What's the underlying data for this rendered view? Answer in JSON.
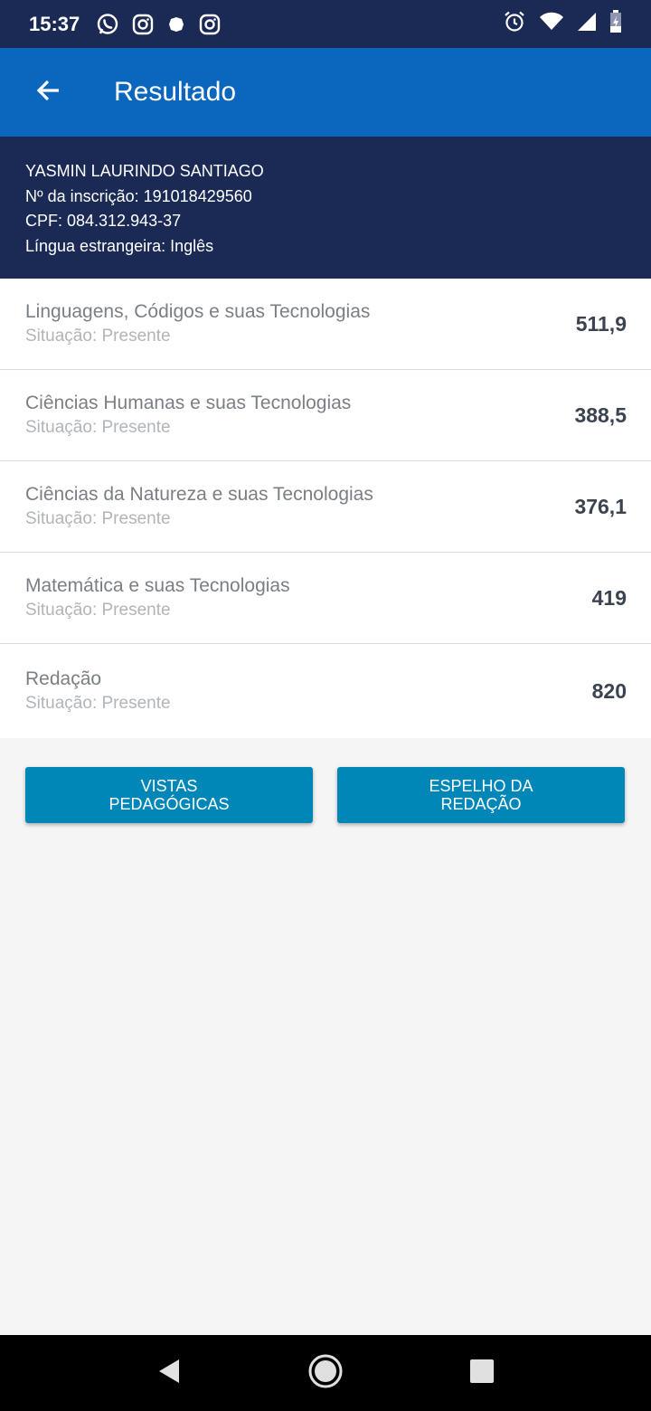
{
  "status_bar": {
    "time": "15:37",
    "left_icons": [
      "whatsapp-icon",
      "instagram-icon",
      "notification-dot-icon",
      "instagram-icon"
    ],
    "right_icons": [
      "alarm-icon",
      "wifi-icon",
      "cell-signal-icon",
      "battery-charging-icon"
    ]
  },
  "app_bar": {
    "title": "Resultado",
    "back_icon": "arrow-left-icon",
    "color": "#0b66bd"
  },
  "candidate": {
    "name": "YASMIN LAURINDO SANTIAGO",
    "registration": "Nº da inscrição: 191018429560",
    "cpf": "CPF: 084.312.943-37",
    "foreign_language": "Língua estrangeira: Inglês",
    "background_color": "#1a2a55"
  },
  "results": [
    {
      "area": "Linguagens, Códigos e suas Tecnologias",
      "status": "Situação: Presente",
      "score": "511,9"
    },
    {
      "area": "Ciências Humanas e suas Tecnologias",
      "status": "Situação: Presente",
      "score": "388,5"
    },
    {
      "area": "Ciências da Natureza e suas Tecnologias",
      "status": "Situação: Presente",
      "score": "376,1"
    },
    {
      "area": "Matemática e suas Tecnologias",
      "status": "Situação: Presente",
      "score": "419"
    },
    {
      "area": "Redação",
      "status": "Situação: Presente",
      "score": "820"
    }
  ],
  "actions": {
    "vistas_label": "VISTAS PEDAGÓGICAS",
    "espelho_label": "ESPELHO DA REDAÇÃO",
    "button_color": "#0087b8"
  },
  "nav_bar": {
    "icons": [
      "back-triangle-icon",
      "home-circle-icon",
      "recents-square-icon"
    ]
  }
}
